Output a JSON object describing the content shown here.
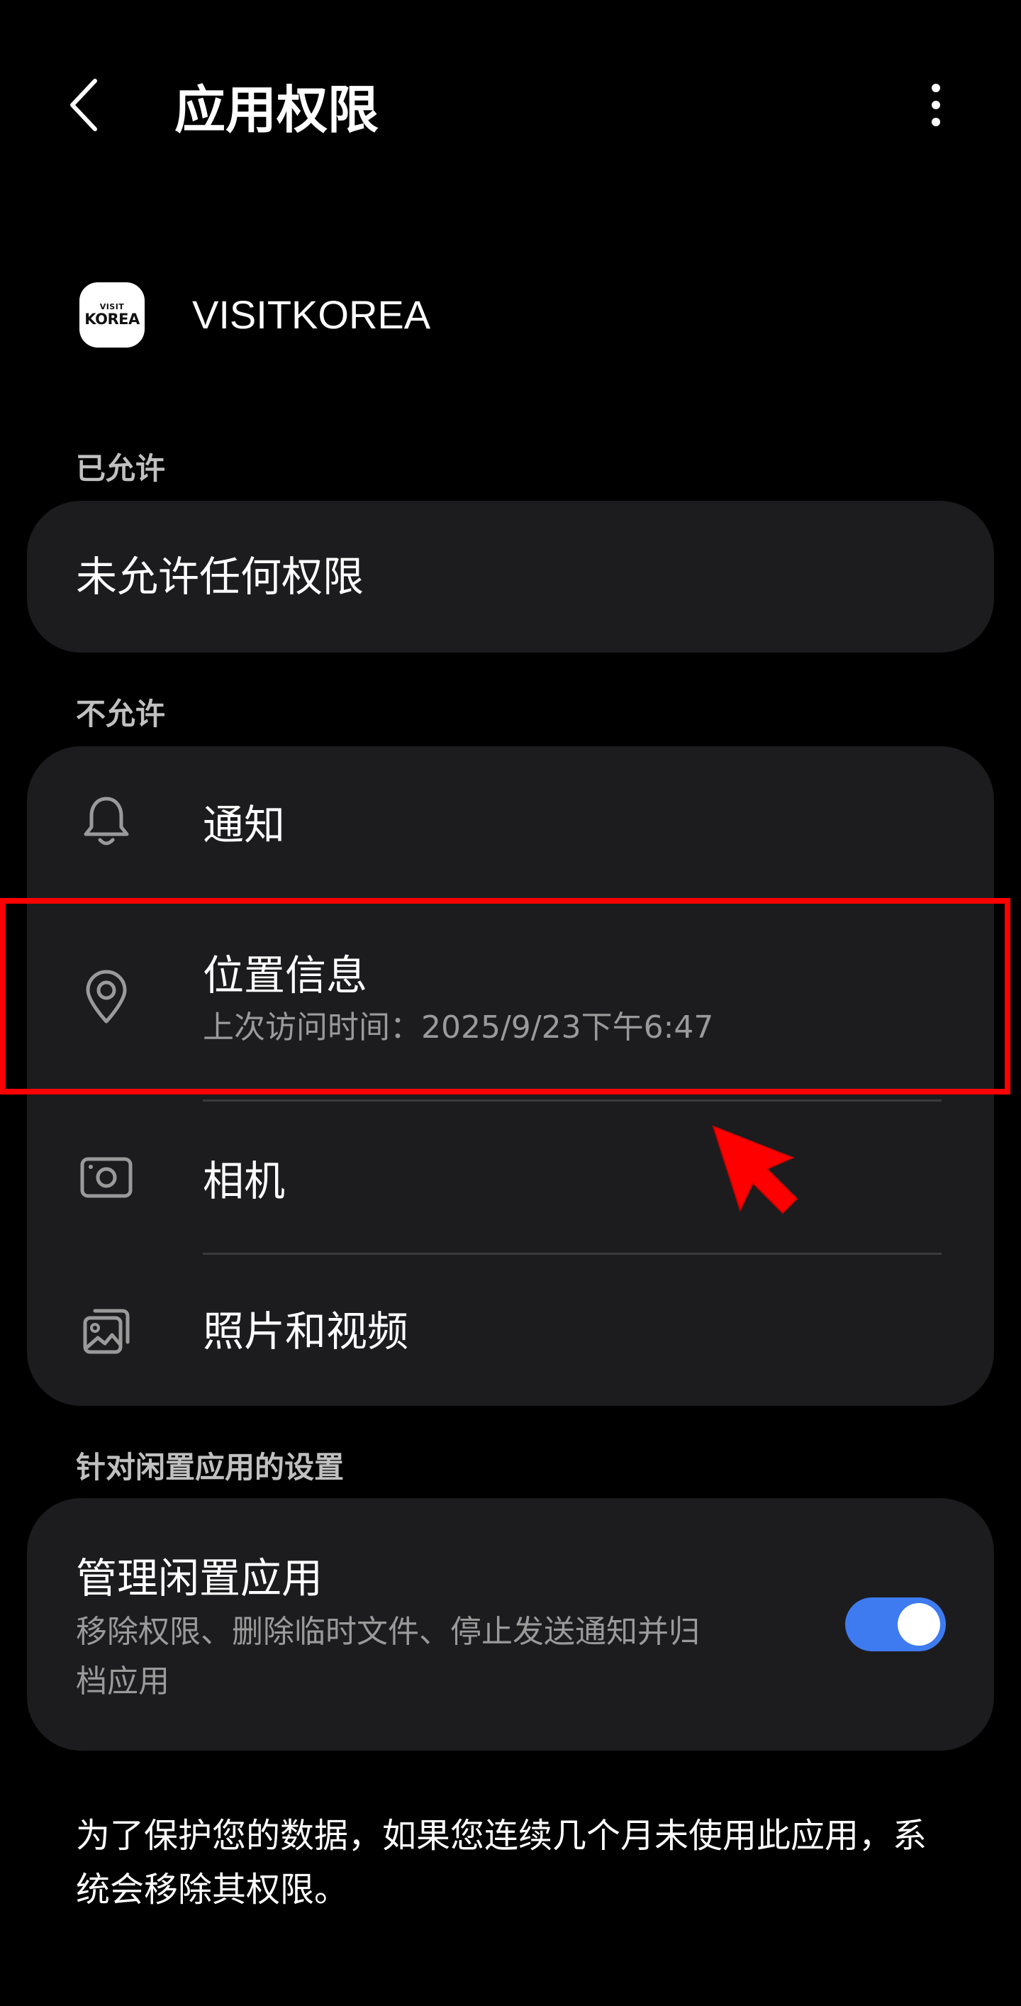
{
  "header": {
    "title": "应用权限"
  },
  "app": {
    "icon_line1": "VISIT",
    "icon_line2": "KOREA",
    "name": "VISITKOREA"
  },
  "allowed": {
    "section_label": "已允许",
    "empty_text": "未允许任何权限"
  },
  "not_allowed": {
    "section_label": "不允许",
    "items": [
      {
        "label": "通知",
        "icon": "bell-icon"
      },
      {
        "label": "位置信息",
        "sub": "上次访问时间：2025/9/23下午6:47",
        "icon": "location-pin-icon"
      },
      {
        "label": "相机",
        "icon": "camera-icon"
      },
      {
        "label": "照片和视频",
        "icon": "photos-icon"
      }
    ]
  },
  "idle_settings": {
    "section_label": "针对闲置应用的设置",
    "title": "管理闲置应用",
    "description_line1": "移除权限、删除临时文件、停止发送通知并归",
    "description_line2": "档应用",
    "toggle_on": true
  },
  "footer": {
    "line1": "为了保护您的数据，如果您连续几个月未使用此应用，系",
    "line2": "统会移除其权限。"
  },
  "colors": {
    "background": "#000000",
    "card": "#1c1c1e",
    "toggle_on": "#3e7bf0",
    "annotation": "#ff0000"
  }
}
